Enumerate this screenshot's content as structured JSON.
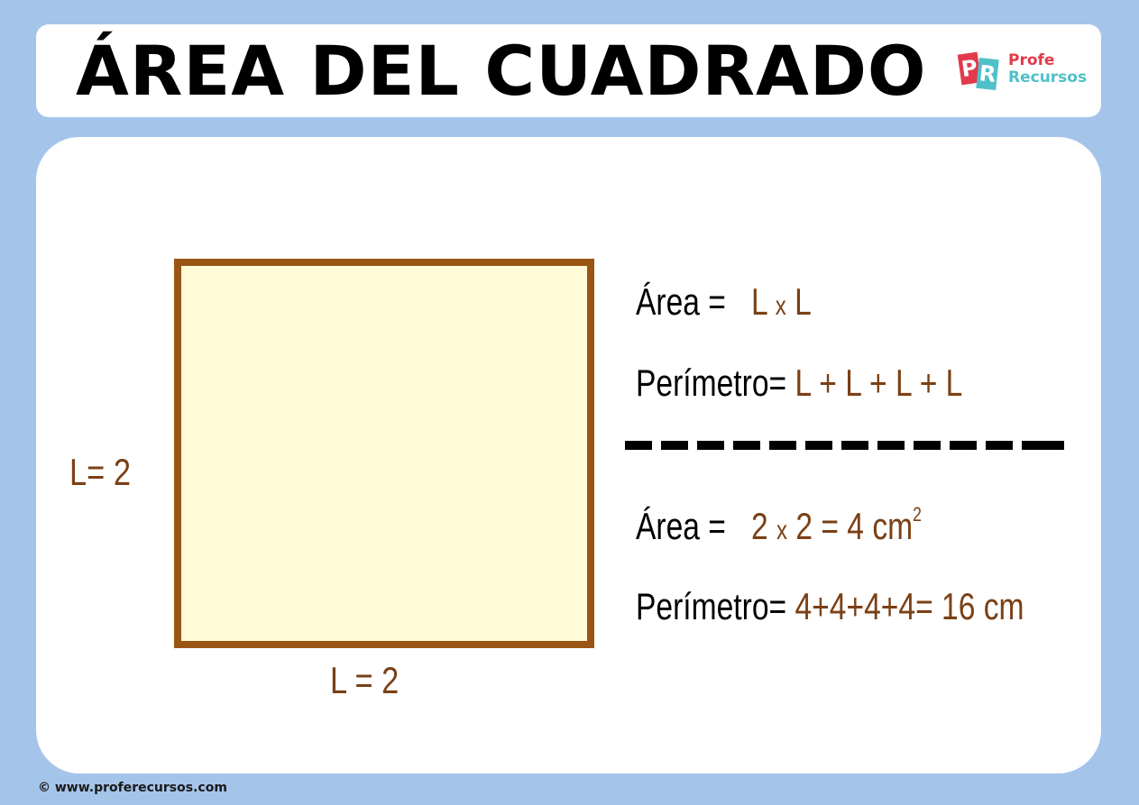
{
  "header": {
    "title": "ÁREA DEL CUADRADO",
    "logo": {
      "p": "P",
      "r": "R",
      "line1": "Profe",
      "line2": "Recursos"
    }
  },
  "figure": {
    "side_left": "L= 2",
    "side_bottom": "L = 2"
  },
  "formulas": {
    "area_label": "Área =",
    "area_expr": {
      "a": "L",
      "x": "x",
      "b": "L"
    },
    "perimeter_label": "Perímetro=",
    "perimeter_expr": "L + L + L + L"
  },
  "example": {
    "area_label": "Área =",
    "area_a": "2",
    "area_x": "x",
    "area_rest": "2 = 4 cm",
    "area_exp": "2",
    "perimeter_label": "Perímetro=",
    "perimeter_expr": "4+4+4+4= 16 cm"
  },
  "footer": {
    "text": "© www.proferecursos.com"
  },
  "colors": {
    "background": "#a5c4ea",
    "accent_brown": "#7a4015",
    "square_fill": "#fffbd6",
    "square_border": "#9a5515"
  }
}
